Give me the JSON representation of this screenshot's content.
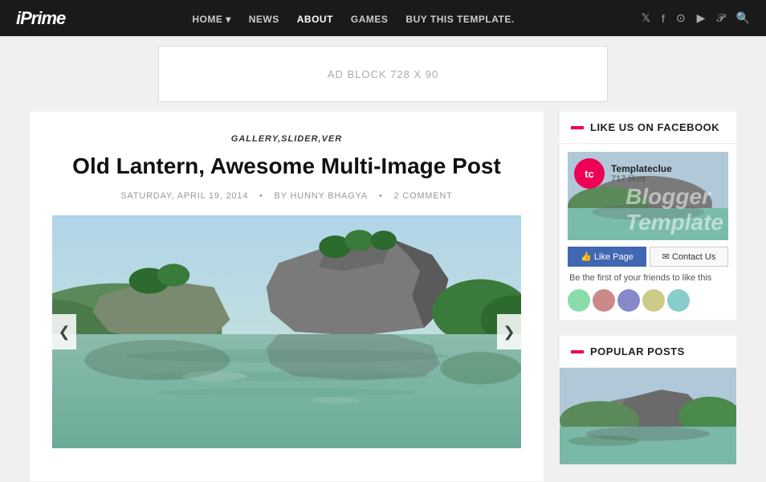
{
  "nav": {
    "logo": "iPrime",
    "links": [
      {
        "label": "HOME",
        "has_dropdown": true
      },
      {
        "label": "NEWS"
      },
      {
        "label": "ABOUT",
        "active": true
      },
      {
        "label": "GAMES"
      },
      {
        "label": "BUY THIS TEMPLATE."
      }
    ],
    "icons": [
      "twitter",
      "facebook",
      "dribbble",
      "youtube",
      "pinterest",
      "search"
    ]
  },
  "ad": {
    "label": "AD BLOCK 728 X 90"
  },
  "article": {
    "categories": "GALLERY,SLIDER,VER",
    "title": "Old Lantern, Awesome Multi-Image Post",
    "meta_date": "SATURDAY, APRIL 19, 2014",
    "meta_by": "BY HUNNY BHAGYA",
    "meta_comments": "2 COMMENT",
    "prev_btn": "❮",
    "next_btn": "❯"
  },
  "sidebar": {
    "facebook_section": {
      "heading": "LIKE US ON FACEBOOK",
      "page_name": "Templateclue",
      "page_likes": "717 likes",
      "bg_text": "Blogger\nTemplate",
      "logo_initials": "tc",
      "btn_like": "👍 Like Page",
      "btn_contact": "✉ Contact Us",
      "friends_text": "Be the first of your friends to like this"
    },
    "popular_section": {
      "heading": "POPULAR POSTS"
    }
  }
}
